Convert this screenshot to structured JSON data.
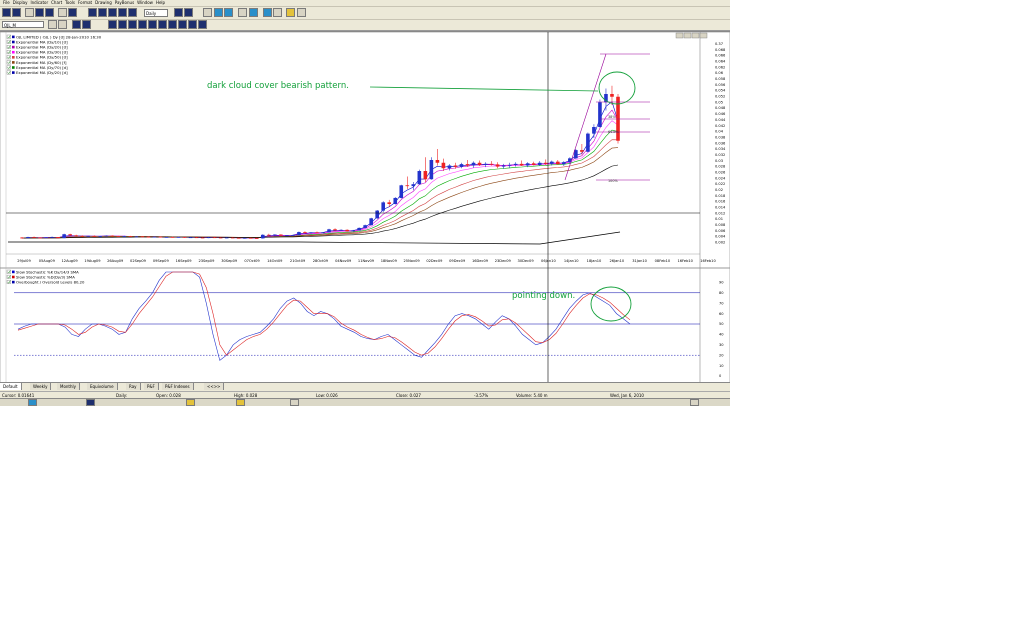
{
  "menu": [
    "File",
    "Display",
    "Indicator",
    "Chart",
    "Tools",
    "Format",
    "Drawing",
    "PayBonus",
    "Window",
    "Help"
  ],
  "toolbar": {
    "interval": "Daily",
    "symbol": "OJL_M"
  },
  "price_panel": {
    "legend": [
      {
        "label": "OJL LIMITED ( OJL ) Dy [d]  28-Jan-2010 16:30",
        "color": "#0000aa"
      },
      {
        "label": "Exponential MA (Dy/10) [d]",
        "color": "#0000aa"
      },
      {
        "label": "Exponential MA (Dy/20) [d]",
        "color": "#aa00aa"
      },
      {
        "label": "Exponential MA (Dy/30) [d]",
        "color": "#ff00ff"
      },
      {
        "label": "Exponential MA (Dy/50) [d]",
        "color": "#d04040"
      },
      {
        "label": "Exponential MA (Dy/60) [f]",
        "color": "#8b4513"
      },
      {
        "label": "Exponential MA (Dy/70) [d]",
        "color": "#008000"
      },
      {
        "label": "Exponential MA (Dy/20) [d]",
        "color": "#0000aa"
      }
    ],
    "annotation": "dark cloud cover bearish pattern.",
    "fib_labels": [
      "38%",
      "61.8%",
      "100%"
    ]
  },
  "osc_panel": {
    "legend": [
      {
        "label": "Slow Stochastic %K Dy/14/3 SMA",
        "color": "#0000cc"
      },
      {
        "label": "Slow Stochastic %D(Dy/3) SMA",
        "color": "#cc0000"
      },
      {
        "label": "Overbought / Oversold Levels 80,20",
        "color": "#0000aa"
      }
    ],
    "annotation": "pointing down.",
    "y_ticks": [
      "90",
      "80",
      "70",
      "60",
      "50",
      "40",
      "30",
      "20",
      "10",
      "0"
    ]
  },
  "chart_data": [
    {
      "type": "candlestick",
      "title": "OJL LIMITED ( OJL ) Dy [d]  28-Jan-2010 16:30",
      "x_tick_labels": [
        "29Jul09",
        "05Aug09",
        "12Aug09",
        "19Aug09",
        "26Aug09",
        "02Sep09",
        "09Sep09",
        "16Sep09",
        "23Sep09",
        "30Sep09",
        "07Oct09",
        "14Oct09",
        "21Oct09",
        "28Oct09",
        "04Nov09",
        "11Nov09",
        "18Nov09",
        "25Nov09",
        "02Dec09",
        "09Dec09",
        "16Dec09",
        "23Dec09",
        "30Dec09",
        "06Jan10",
        "14Jan10",
        "18Jan10",
        "26Jan10",
        "31Jan10",
        "08Feb10",
        "16Feb10",
        "16Feb10"
      ],
      "y_tick_labels": [
        "0.37",
        "0.068",
        "0.066",
        "0.064",
        "0.062",
        "0.06",
        "0.058",
        "0.056",
        "0.054",
        "0.052",
        "0.05",
        "0.048",
        "0.046",
        "0.044",
        "0.042",
        "0.04",
        "0.038",
        "0.036",
        "0.034",
        "0.032",
        "0.03",
        "0.028",
        "0.026",
        "0.024",
        "0.022",
        "0.02",
        "0.018",
        "0.016",
        "0.014",
        "0.012",
        "0.01",
        "0.008",
        "0.006",
        "0.004",
        "0.002"
      ],
      "candles": [
        [
          0.0038,
          0.004,
          0.0034,
          0.0036
        ],
        [
          0.0036,
          0.0041,
          0.0036,
          0.004
        ],
        [
          0.004,
          0.0042,
          0.0038,
          0.0038
        ],
        [
          0.0038,
          0.0039,
          0.0036,
          0.0037
        ],
        [
          0.0037,
          0.004,
          0.0036,
          0.0039
        ],
        [
          0.0039,
          0.0041,
          0.0038,
          0.004
        ],
        [
          0.004,
          0.004,
          0.0036,
          0.0036
        ],
        [
          0.0036,
          0.0052,
          0.0036,
          0.005
        ],
        [
          0.005,
          0.0052,
          0.0044,
          0.0046
        ],
        [
          0.0046,
          0.0048,
          0.0042,
          0.0044
        ],
        [
          0.0044,
          0.0046,
          0.004,
          0.0042
        ],
        [
          0.0042,
          0.0044,
          0.004,
          0.0044
        ],
        [
          0.0044,
          0.0046,
          0.0041,
          0.0042
        ],
        [
          0.0042,
          0.0044,
          0.004,
          0.0043
        ],
        [
          0.0043,
          0.0046,
          0.0042,
          0.0045
        ],
        [
          0.0045,
          0.0046,
          0.0042,
          0.0043
        ],
        [
          0.0043,
          0.0044,
          0.004,
          0.0042
        ],
        [
          0.0042,
          0.0044,
          0.004,
          0.0043
        ],
        [
          0.0043,
          0.0044,
          0.004,
          0.0041
        ],
        [
          0.0041,
          0.0043,
          0.0039,
          0.0042
        ],
        [
          0.0042,
          0.0043,
          0.004,
          0.0041
        ],
        [
          0.0041,
          0.0042,
          0.0039,
          0.004
        ],
        [
          0.004,
          0.0042,
          0.0038,
          0.0041
        ],
        [
          0.0041,
          0.0042,
          0.0038,
          0.0039
        ],
        [
          0.0039,
          0.0041,
          0.0038,
          0.004
        ],
        [
          0.004,
          0.0041,
          0.0038,
          0.0039
        ],
        [
          0.0039,
          0.0041,
          0.0038,
          0.004
        ],
        [
          0.004,
          0.004,
          0.0037,
          0.0038
        ],
        [
          0.0038,
          0.004,
          0.0037,
          0.0039
        ],
        [
          0.0039,
          0.004,
          0.0037,
          0.0038
        ],
        [
          0.0038,
          0.0039,
          0.0036,
          0.0037
        ],
        [
          0.0037,
          0.004,
          0.0036,
          0.0039
        ],
        [
          0.0039,
          0.004,
          0.0037,
          0.0038
        ],
        [
          0.0038,
          0.0039,
          0.0036,
          0.0037
        ],
        [
          0.0037,
          0.0039,
          0.0036,
          0.0038
        ],
        [
          0.0038,
          0.0039,
          0.0036,
          0.0037
        ],
        [
          0.0037,
          0.0038,
          0.0035,
          0.0036
        ],
        [
          0.0036,
          0.0038,
          0.0034,
          0.0037
        ],
        [
          0.0037,
          0.0038,
          0.0035,
          0.0036
        ],
        [
          0.0036,
          0.0037,
          0.0034,
          0.0035
        ],
        [
          0.0035,
          0.005,
          0.0034,
          0.0048
        ],
        [
          0.0048,
          0.0052,
          0.0044,
          0.0046
        ],
        [
          0.0046,
          0.005,
          0.0043,
          0.0049
        ],
        [
          0.0049,
          0.005,
          0.0044,
          0.0045
        ],
        [
          0.0045,
          0.0047,
          0.0043,
          0.0046
        ],
        [
          0.0046,
          0.0048,
          0.0044,
          0.0047
        ],
        [
          0.0047,
          0.006,
          0.0046,
          0.0058
        ],
        [
          0.0058,
          0.0061,
          0.0053,
          0.0055
        ],
        [
          0.0055,
          0.0058,
          0.0052,
          0.0057
        ],
        [
          0.0057,
          0.006,
          0.0055,
          0.0056
        ],
        [
          0.0056,
          0.0058,
          0.0054,
          0.0057
        ],
        [
          0.0057,
          0.007,
          0.0056,
          0.0068
        ],
        [
          0.0068,
          0.0072,
          0.0063,
          0.0064
        ],
        [
          0.0064,
          0.0068,
          0.0062,
          0.0066
        ],
        [
          0.0066,
          0.0068,
          0.006,
          0.0061
        ],
        [
          0.0061,
          0.0066,
          0.006,
          0.0064
        ],
        [
          0.0064,
          0.0075,
          0.0063,
          0.0073
        ],
        [
          0.0073,
          0.0085,
          0.0072,
          0.0083
        ],
        [
          0.0083,
          0.011,
          0.0082,
          0.0108
        ],
        [
          0.0108,
          0.0138,
          0.0106,
          0.0136
        ],
        [
          0.0136,
          0.017,
          0.013,
          0.0166
        ],
        [
          0.0166,
          0.0175,
          0.015,
          0.016
        ],
        [
          0.016,
          0.0185,
          0.0158,
          0.0182
        ],
        [
          0.0182,
          0.023,
          0.018,
          0.0228
        ],
        [
          0.0228,
          0.026,
          0.0215,
          0.0225
        ],
        [
          0.0225,
          0.024,
          0.021,
          0.0232
        ],
        [
          0.0232,
          0.0285,
          0.023,
          0.028
        ],
        [
          0.028,
          0.033,
          0.024,
          0.025
        ],
        [
          0.025,
          0.033,
          0.0248,
          0.032
        ],
        [
          0.032,
          0.036,
          0.03,
          0.031
        ],
        [
          0.031,
          0.0325,
          0.028,
          0.029
        ],
        [
          0.029,
          0.0305,
          0.0282,
          0.03
        ],
        [
          0.03,
          0.031,
          0.0288,
          0.0295
        ],
        [
          0.0295,
          0.031,
          0.029,
          0.0305
        ],
        [
          0.0305,
          0.032,
          0.0295,
          0.03
        ],
        [
          0.03,
          0.0315,
          0.0292,
          0.031
        ],
        [
          0.031,
          0.0318,
          0.0298,
          0.0302
        ],
        [
          0.0302,
          0.0312,
          0.0294,
          0.0306
        ],
        [
          0.0306,
          0.0316,
          0.03,
          0.0304
        ],
        [
          0.0304,
          0.0312,
          0.029,
          0.0296
        ],
        [
          0.0296,
          0.0306,
          0.0288,
          0.03
        ],
        [
          0.03,
          0.031,
          0.0292,
          0.0302
        ],
        [
          0.0302,
          0.0312,
          0.0296,
          0.0306
        ],
        [
          0.0306,
          0.0318,
          0.0298,
          0.03
        ],
        [
          0.03,
          0.0312,
          0.0294,
          0.0308
        ],
        [
          0.0308,
          0.0314,
          0.03,
          0.0302
        ],
        [
          0.0302,
          0.0316,
          0.0298,
          0.031
        ],
        [
          0.031,
          0.0322,
          0.0302,
          0.0306
        ],
        [
          0.0306,
          0.0318,
          0.03,
          0.0314
        ],
        [
          0.0314,
          0.032,
          0.0302,
          0.0305
        ],
        [
          0.0305,
          0.0316,
          0.0298,
          0.0312
        ],
        [
          0.0312,
          0.033,
          0.0306,
          0.0326
        ],
        [
          0.0326,
          0.036,
          0.0324,
          0.0356
        ],
        [
          0.0356,
          0.0378,
          0.034,
          0.035
        ],
        [
          0.035,
          0.042,
          0.0348,
          0.0416
        ],
        [
          0.0416,
          0.045,
          0.04,
          0.044
        ],
        [
          0.044,
          0.054,
          0.0438,
          0.053
        ],
        [
          0.053,
          0.058,
          0.05,
          0.056
        ],
        [
          0.056,
          0.059,
          0.052,
          0.055
        ],
        [
          0.055,
          0.056,
          0.038,
          0.039
        ]
      ]
    },
    {
      "type": "line",
      "title": "Slow Stochastic",
      "y_ticks": [
        90,
        80,
        70,
        60,
        50,
        40,
        30,
        20,
        10,
        0
      ],
      "series": [
        {
          "name": "Slow Stochastic %K Dy/14/3 SMA",
          "values": [
            45,
            48,
            50,
            50,
            50,
            50,
            50,
            47,
            40,
            38,
            45,
            50,
            50,
            48,
            45,
            40,
            42,
            55,
            65,
            72,
            80,
            92,
            100,
            100,
            100,
            100,
            100,
            95,
            70,
            40,
            15,
            20,
            30,
            35,
            38,
            40,
            42,
            48,
            55,
            65,
            72,
            75,
            70,
            62,
            58,
            62,
            60,
            55,
            48,
            45,
            42,
            38,
            36,
            35,
            38,
            40,
            35,
            30,
            25,
            20,
            18,
            25,
            32,
            40,
            50,
            58,
            60,
            58,
            55,
            50,
            45,
            52,
            58,
            55,
            48,
            40,
            35,
            30,
            32,
            38,
            45,
            55,
            65,
            72,
            78,
            80,
            76,
            72,
            68,
            60,
            55,
            50
          ]
        },
        {
          "name": "Slow Stochastic %D(Dy/3) SMA",
          "values": [
            44,
            46,
            48,
            50,
            50,
            50,
            50,
            49,
            45,
            40,
            42,
            47,
            50,
            49,
            47,
            43,
            42,
            50,
            60,
            68,
            76,
            86,
            96,
            100,
            100,
            100,
            100,
            98,
            85,
            60,
            30,
            20,
            25,
            30,
            35,
            38,
            40,
            45,
            52,
            60,
            68,
            73,
            72,
            66,
            60,
            60,
            60,
            57,
            51,
            47,
            44,
            40,
            37,
            35,
            36,
            38,
            37,
            33,
            28,
            23,
            20,
            22,
            28,
            36,
            45,
            53,
            58,
            59,
            57,
            53,
            48,
            49,
            54,
            55,
            51,
            45,
            39,
            33,
            32,
            35,
            41,
            50,
            60,
            68,
            75,
            79,
            78,
            75,
            71,
            65,
            59,
            54
          ]
        }
      ],
      "levels": [
        80,
        20
      ]
    }
  ],
  "bottom_tabs": [
    "Default",
    "Weekly",
    "Monthly",
    "Equivolume",
    "Ray",
    "P&F",
    "P&F Indexes",
    "<<>>"
  ],
  "status": {
    "cursor": "Cursor: 0.01641",
    "date": "Daily:",
    "open": "Open: 0.028",
    "high": "High: 0.028",
    "low": "Low: 0.026",
    "close": "Close: 0.027",
    "change": "-3.57%",
    "volume": "Volume: 5.40 m",
    "when": "Wed, Jan 6, 2010"
  }
}
